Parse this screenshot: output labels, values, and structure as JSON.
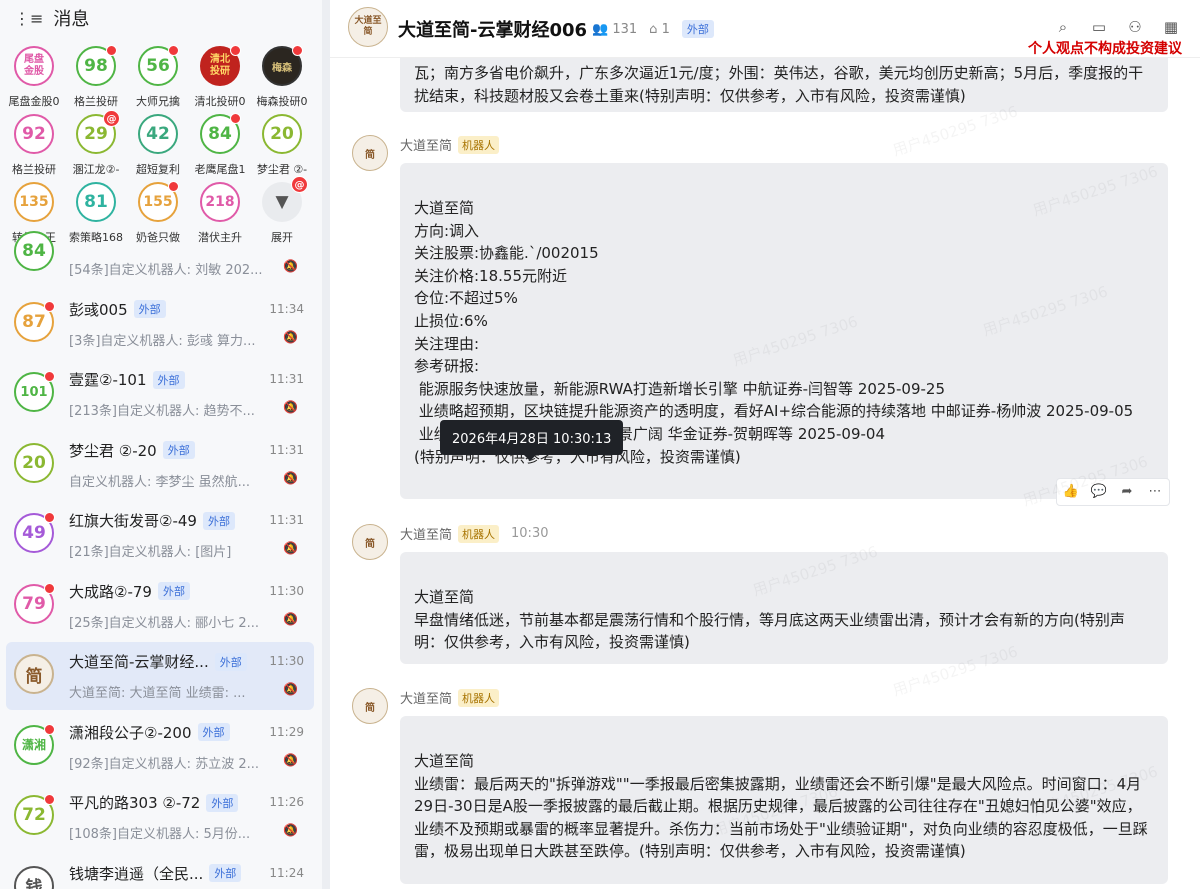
{
  "sidebar": {
    "title": "消息",
    "tiles": [
      {
        "label": "尾盘\n金股",
        "name": "尾盘金股0",
        "color": "#e05aa8",
        "badge": "none"
      },
      {
        "label": "98",
        "name": "格兰投研",
        "color": "#4fb545",
        "badge": "dot"
      },
      {
        "label": "56",
        "name": "大师兄擒",
        "color": "#4fb545",
        "badge": "dot"
      },
      {
        "label": "清北\n投研",
        "name": "清北投研0",
        "color": "#c0231e",
        "badge": "dot"
      },
      {
        "label": "梅森",
        "name": "梅森投研0",
        "color": "#333333",
        "badge": "dot"
      },
      {
        "label": "92",
        "name": "格兰投研",
        "color": "#e05aa8",
        "badge": "none"
      },
      {
        "label": "29",
        "name": "溷江龙②-",
        "color": "#8bb832",
        "badge": "at"
      },
      {
        "label": "42",
        "name": "超短复利",
        "color": "#3aa87e",
        "badge": "none"
      },
      {
        "label": "84",
        "name": "老鹰尾盘1",
        "color": "#4fb545",
        "badge": "dot"
      },
      {
        "label": "20",
        "name": "梦尘君 ②-",
        "color": "#8bb832",
        "badge": "none"
      },
      {
        "label": "135",
        "name": "转债小王",
        "color": "#e6a23c",
        "badge": "none"
      },
      {
        "label": "81",
        "name": "索策略168",
        "color": "#2fb3a0",
        "badge": "none"
      },
      {
        "label": "155",
        "name": "奶爸只做",
        "color": "#e6a23c",
        "badge": "dot"
      },
      {
        "label": "218",
        "name": "潜伏主升",
        "color": "#e05aa8",
        "badge": "none"
      },
      {
        "label": "▼",
        "name": "展开",
        "color": "#dddddd",
        "badge": "at"
      }
    ],
    "conversations": [
      {
        "avatar": "84",
        "color": "#4fb545",
        "name": "",
        "tag": "",
        "time": "",
        "preview": "[54条]自定义机器人: 刘敏 202...",
        "dot": false
      },
      {
        "avatar": "87",
        "color": "#e6a23c",
        "name": "彭彧005",
        "tag": "外部",
        "time": "11:34",
        "preview": "[3条]自定义机器人: 彭彧 算力...",
        "dot": true
      },
      {
        "avatar": "101",
        "color": "#4fb545",
        "name": "壹霆②-101",
        "tag": "外部",
        "time": "11:31",
        "preview": "[213条]自定义机器人: 趋势不...",
        "dot": true
      },
      {
        "avatar": "20",
        "color": "#8bb832",
        "name": "梦尘君 ②-20",
        "tag": "外部",
        "time": "11:31",
        "preview": "自定义机器人: 李梦尘 虽然航...",
        "dot": false
      },
      {
        "avatar": "49",
        "color": "#a55ad8",
        "name": "红旗大街发哥②-49",
        "tag": "外部",
        "time": "11:31",
        "preview": "[21条]自定义机器人: [图片]",
        "dot": true
      },
      {
        "avatar": "79",
        "color": "#e05aa8",
        "name": "大成路②-79",
        "tag": "外部",
        "time": "11:30",
        "preview": "[25条]自定义机器人: 郦小七 2...",
        "dot": true
      },
      {
        "avatar": "简",
        "color": "#c9b38f",
        "name": "大道至简-云掌财经...",
        "tag": "外部",
        "time": "11:30",
        "preview": "大道至简: 大道至简 业绩雷: ...",
        "dot": false
      },
      {
        "avatar": "潇湘",
        "color": "#4fb545",
        "name": "潇湘段公子②-200",
        "tag": "外部",
        "time": "11:29",
        "preview": "[92条]自定义机器人: 苏立波 2...",
        "dot": true
      },
      {
        "avatar": "72",
        "color": "#8bb832",
        "name": "平凡的路303 ②-72",
        "tag": "外部",
        "time": "11:26",
        "preview": "[108条]自定义机器人: 5月份...",
        "dot": true
      },
      {
        "avatar": "钱",
        "color": "#555555",
        "name": "钱塘李逍遥（全民...",
        "tag": "外部",
        "time": "11:24",
        "preview": "",
        "dot": false
      }
    ]
  },
  "channel": {
    "avatar": "大道至简",
    "title": "大道至简-云掌财经006",
    "members": "131",
    "bots": "1",
    "tag": "外部",
    "disclaimer": "个人观点不构成投资建议",
    "icons": [
      "search-icon",
      "video-icon",
      "add-member-icon",
      "calendar-icon"
    ]
  },
  "messages": [
    {
      "sender": "",
      "tag": "",
      "time": "",
      "text": "瓦；南方多省电价飙升，广东多次逼近1元/度；外围：英伟达，谷歌，美元均创历史新高；5月后，季度报的干扰结束，科技题材股又会卷土重来(特别声明：仅供参考，入市有风险，投资需谨慎)"
    },
    {
      "sender": "大道至简",
      "tag": "机器人",
      "time": "",
      "text": "大道至简\n方向:调入\n关注股票:协鑫能.`/002015\n关注价格:18.55元附近\n仓位:不超过5%\n止损位:6%\n关注理由:\n参考研报:\n 能源服务快速放量，新能源RWA打造新增长引擎 中航证券-闫智等 2025-09-25\n 业绩略超预期，区块链提升能源资产的透明度，看好AI+综合能源的持续落地 中邮证券-杨帅波 2025-09-05\n 业绩稳健增长，新能源RWA前景广阔 华金证券-贺朝晖等 2025-09-04\n(特别声明：仅供参考，入市有风险，投资需谨慎)"
    },
    {
      "sender": "大道至简",
      "tag": "机器人",
      "time": "10:30",
      "text": "大道至简\n早盘情绪低迷，节前基本都是震荡行情和个股行情，等月底这两天业绩雷出清，预计才会有新的方向(特别声明：仅供参考，入市有风险，投资需谨慎)"
    },
    {
      "sender": "大道至简",
      "tag": "机器人",
      "time": "",
      "text": "大道至简\n业绩雷：最后两天的\"拆弹游戏\"\"一季报最后密集披露期，业绩雷还会不断引爆\"是最大风险点。时间窗口：4月29日-30日是A股一季报披露的最后截止期。根据历史规律，最后披露的公司往往存在\"丑媳妇怕见公婆\"效应，业绩不及预期或暴雷的概率显著提升。杀伤力：当前市场处于\"业绩验证期\"，对负向业绩的容忍度极低，一旦踩雷，极易出现单日大跌甚至跌停。(特别声明：仅供参考，入市有风险，投资需谨慎)"
    }
  ],
  "tooltip": "2026年4月28日 10:30:13",
  "watermark": "用户450295 7306"
}
